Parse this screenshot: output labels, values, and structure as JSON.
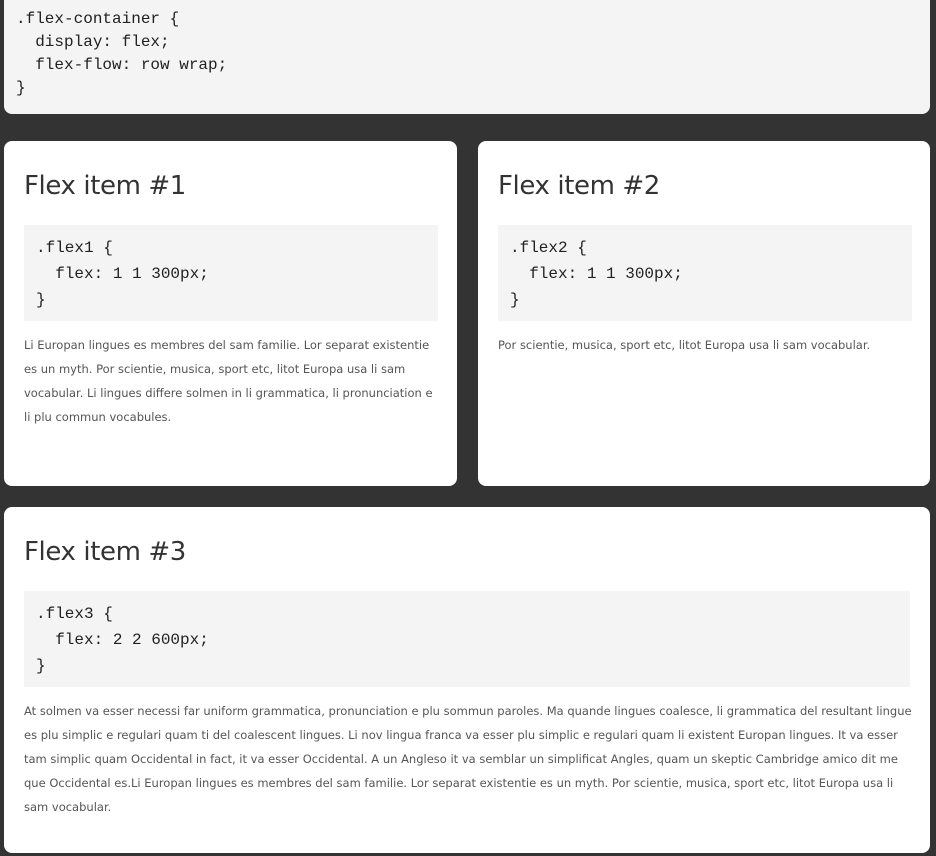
{
  "container_css": {
    "code": ".flex-container {\n  display: flex;\n  flex-flow: row wrap;\n}"
  },
  "items": [
    {
      "title": "Flex item #1",
      "code": ".flex1 {\n  flex: 1 1 300px;\n}",
      "text": "Li Europan lingues es membres del sam familie. Lor separat existentie es un myth. Por scientie, musica, sport etc, litot Europa usa li sam vocabular. Li lingues differe solmen in li grammatica, li pronunciation e li plu commun vocabules."
    },
    {
      "title": "Flex item #2",
      "code": ".flex2 {\n  flex: 1 1 300px;\n}",
      "text": "Por scientie, musica, sport etc, litot Europa usa li sam vocabular."
    },
    {
      "title": "Flex item #3",
      "code": ".flex3 {\n  flex: 2 2 600px;\n}",
      "text": "At solmen va esser necessi far uniform grammatica, pronunciation e plu sommun paroles. Ma quande lingues coalesce, li grammatica del resultant lingue es plu simplic e regulari quam ti del coalescent lingues. Li nov lingua franca va esser plu simplic e regulari quam li existent Europan lingues. It va esser tam simplic quam Occidental in fact, it va esser Occidental. A un Angleso it va semblar un simplificat Angles, quam un skeptic Cambridge amico dit me que Occidental es.Li Europan lingues es membres del sam familie. Lor separat existentie es un myth. Por scientie, musica, sport etc, litot Europa usa li sam vocabular."
    }
  ],
  "colors": {
    "background": "#333333",
    "card": "#ffffff",
    "code_bg": "#f4f4f4"
  }
}
